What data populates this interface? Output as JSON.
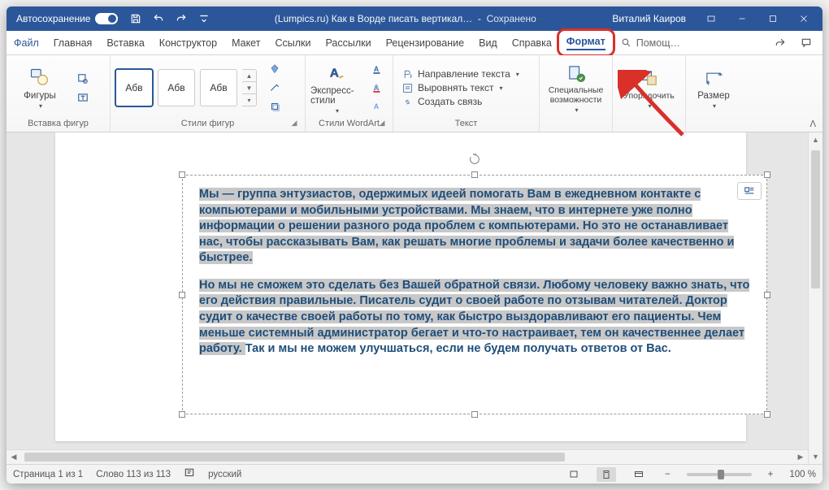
{
  "titlebar": {
    "autosave_label": "Автосохранение",
    "doc_title": "(Lumpics.ru) Как в Ворде писать вертикал…",
    "saved_status": "Сохранено",
    "username": "Виталий Каиров"
  },
  "tabs": {
    "file": "Файл",
    "home": "Главная",
    "insert": "Вставка",
    "design": "Конструктор",
    "layout": "Макет",
    "references": "Ссылки",
    "mailings": "Рассылки",
    "review": "Рецензирование",
    "view": "Вид",
    "help": "Справка",
    "format": "Формат",
    "search_placeholder": "Помощ…"
  },
  "ribbon": {
    "shapes_label": "Фигуры",
    "group_insert": "Вставка фигур",
    "gallery_sample": "Абв",
    "group_stylesfig": "Стили фигур",
    "express_styles": "Экспресс-стили",
    "group_wordart": "Стили WordArt",
    "text_direction": "Направление текста",
    "align_text": "Выровнять текст",
    "create_link": "Создать связь",
    "group_text": "Текст",
    "accessibility": "Специальные возможности",
    "arrange": "Упорядочить",
    "size": "Размер"
  },
  "document": {
    "p1_sel": "Мы — группа энтузиастов, одержимых идеей помогать Вам в ежедневном контакте с компьютерами и мобильными устройствами. Мы знаем, что в интернете уже полно информации о решении разного рода проблем с компьютерами. Но это не останавливает нас, чтобы рассказывать Вам, как решать многие проблемы и задачи более качественно и быстрее.",
    "p2_sel": "Но мы не сможем это сделать без Вашей обратной связи. Любому человеку важно знать, что его действия правильные. Писатель судит о своей работе по отзывам читателей. Доктор судит о качестве своей работы по тому, как быстро выздоравливают его пациенты. Чем меньше системный администратор бегает и что-то настраивает, тем он качественнее делает работу. ",
    "p2_nosel": "Так и мы не можем улучшаться, если не будем получать ответов от Вас."
  },
  "statusbar": {
    "page": "Страница 1 из 1",
    "words": "Слово 113 из 113",
    "lang": "русский",
    "zoom": "100 %"
  }
}
